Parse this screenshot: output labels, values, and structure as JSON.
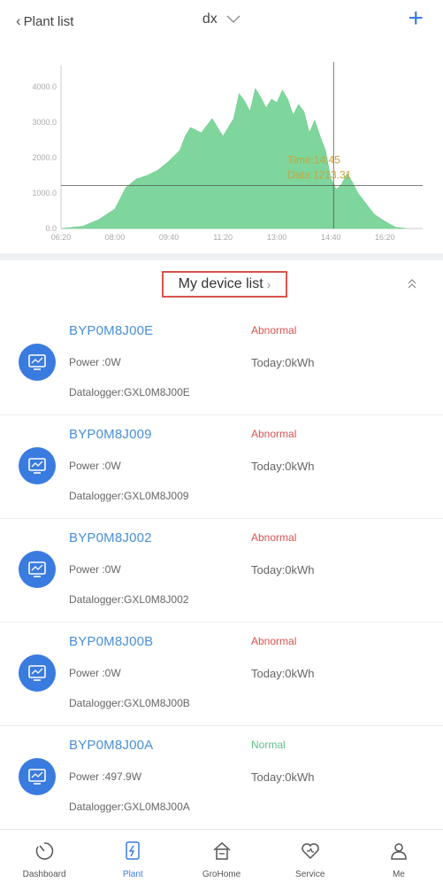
{
  "header": {
    "back_label": "Plant list",
    "plant_name": "dx",
    "add_label": "+"
  },
  "chart_data": {
    "type": "area",
    "title": "",
    "xlabel": "",
    "ylabel": "",
    "x_ticks": [
      "06:20",
      "08:00",
      "09:40",
      "11:20",
      "13:00",
      "14:40",
      "16:20"
    ],
    "y_ticks": [
      "0.0",
      "1000.0",
      "2000.0",
      "3000.0",
      "4000.0"
    ],
    "ylim": [
      0,
      4400
    ],
    "xlim_minutes": [
      380,
      1050
    ],
    "grid": false,
    "series": [
      {
        "color": "#7ed69c",
        "x": [
          "06:20",
          "07:00",
          "07:30",
          "08:00",
          "08:20",
          "08:40",
          "09:00",
          "09:20",
          "09:40",
          "10:00",
          "10:10",
          "10:20",
          "10:40",
          "11:00",
          "11:20",
          "11:40",
          "11:50",
          "12:00",
          "12:10",
          "12:20",
          "12:30",
          "12:40",
          "12:50",
          "13:00",
          "13:10",
          "13:20",
          "13:30",
          "13:40",
          "13:50",
          "14:00",
          "14:10",
          "14:20",
          "14:30",
          "14:40",
          "14:50",
          "15:00",
          "15:10",
          "15:20",
          "15:30",
          "15:40",
          "15:50",
          "16:00",
          "16:20",
          "16:40",
          "17:00"
        ],
        "y": [
          0,
          60,
          250,
          550,
          1150,
          1400,
          1500,
          1650,
          1900,
          2200,
          2600,
          2850,
          2700,
          3100,
          2600,
          3100,
          3800,
          3600,
          3300,
          3950,
          3700,
          3400,
          3650,
          3550,
          3900,
          3650,
          3200,
          3500,
          3300,
          2700,
          3050,
          2600,
          2200,
          1400,
          1100,
          1250,
          1550,
          1300,
          1000,
          800,
          600,
          400,
          200,
          30,
          0
        ]
      }
    ],
    "crosshair": {
      "time": "14:45",
      "value": 1213.31
    },
    "tooltip": {
      "time_text": "Time:14:45",
      "data_text": "Data:1213.31"
    }
  },
  "device_list": {
    "title": "My device list",
    "items": [
      {
        "name": "BYP0M8J00E",
        "status": "Abnormal",
        "status_color": "#d9534f",
        "power": "Power :0W",
        "today": "Today:0kWh",
        "datalogger": "Datalogger:GXL0M8J00E"
      },
      {
        "name": "BYP0M8J009",
        "status": "Abnormal",
        "status_color": "#d9534f",
        "power": "Power :0W",
        "today": "Today:0kWh",
        "datalogger": "Datalogger:GXL0M8J009"
      },
      {
        "name": "BYP0M8J002",
        "status": "Abnormal",
        "status_color": "#d9534f",
        "power": "Power :0W",
        "today": "Today:0kWh",
        "datalogger": "Datalogger:GXL0M8J002"
      },
      {
        "name": "BYP0M8J00B",
        "status": "Abnormal",
        "status_color": "#d9534f",
        "power": "Power :0W",
        "today": "Today:0kWh",
        "datalogger": "Datalogger:GXL0M8J00B"
      },
      {
        "name": "BYP0M8J00A",
        "status": "Normal",
        "status_color": "#5cc08a",
        "power": "Power :497.9W",
        "today": "Today:0kWh",
        "datalogger": "Datalogger:GXL0M8J00A"
      }
    ]
  },
  "bottom_nav": [
    {
      "label": "Dashboard",
      "icon": "dashboard-icon",
      "active": false
    },
    {
      "label": "Plant",
      "icon": "plant-icon",
      "active": true
    },
    {
      "label": "GroHome",
      "icon": "home-icon",
      "active": false
    },
    {
      "label": "Service",
      "icon": "service-icon",
      "active": false
    },
    {
      "label": "Me",
      "icon": "user-icon",
      "active": false
    }
  ],
  "colors": {
    "accent": "#3a7be0",
    "device_name": "#4a8fd8",
    "chart_fill": "#7ed69c",
    "tooltip_text": "#c9a43a",
    "highlight_border": "#d9534f"
  }
}
